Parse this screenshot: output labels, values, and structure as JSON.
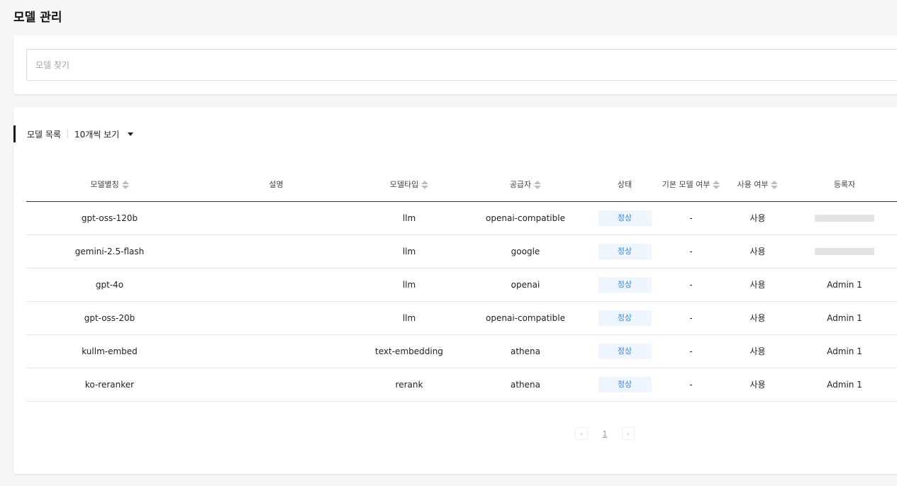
{
  "page": {
    "title": "모델 관리"
  },
  "search": {
    "placeholder": "모델 찾기",
    "value": ""
  },
  "list": {
    "title": "모델 목록",
    "page_size": "10개씩 보기",
    "columns": [
      "모델별칭",
      "설명",
      "모델타입",
      "공급자",
      "상태",
      "기본 모델 여부",
      "사용 여부",
      "등록자"
    ],
    "rows": [
      {
        "alias": "gpt-oss-120b",
        "description": "",
        "type": "llm",
        "provider": "openai-compatible",
        "status": "정상",
        "is_default": "-",
        "in_use": "사용",
        "registrant": ""
      },
      {
        "alias": "gemini-2.5-flash",
        "description": "",
        "type": "llm",
        "provider": "google",
        "status": "정상",
        "is_default": "-",
        "in_use": "사용",
        "registrant": ""
      },
      {
        "alias": "gpt-4o",
        "description": "",
        "type": "llm",
        "provider": "openai",
        "status": "정상",
        "is_default": "-",
        "in_use": "사용",
        "registrant": "Admin 1"
      },
      {
        "alias": "gpt-oss-20b",
        "description": "",
        "type": "llm",
        "provider": "openai-compatible",
        "status": "정상",
        "is_default": "-",
        "in_use": "사용",
        "registrant": "Admin 1"
      },
      {
        "alias": "kullm-embed",
        "description": "",
        "type": "text-embedding",
        "provider": "athena",
        "status": "정상",
        "is_default": "-",
        "in_use": "사용",
        "registrant": "Admin 1"
      },
      {
        "alias": "ko-reranker",
        "description": "",
        "type": "rerank",
        "provider": "athena",
        "status": "정상",
        "is_default": "-",
        "in_use": "사용",
        "registrant": "Admin 1"
      }
    ]
  },
  "pagination": {
    "prev": "‹",
    "current": "1",
    "next": "›"
  },
  "colors": {
    "status_bg": "#eef5fd",
    "status_text": "#3a87d6",
    "accent": "#1a1a1a"
  },
  "icons": {
    "sort": "sort-updown-icon",
    "dropdown": "caret-down-icon",
    "prev": "chevron-left-icon",
    "next": "chevron-right-icon"
  }
}
